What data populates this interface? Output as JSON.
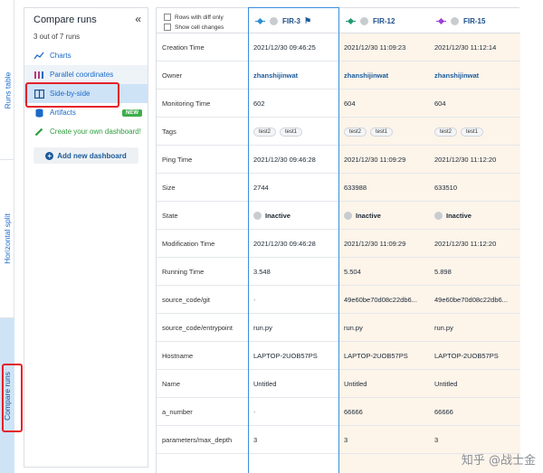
{
  "rail": {
    "tabs": [
      {
        "label": "Runs table"
      },
      {
        "label": "Horizontal split"
      },
      {
        "label": "Compare runs"
      }
    ]
  },
  "panel": {
    "title": "Compare runs",
    "subtitle": "3 out of 7 runs",
    "menu": [
      {
        "label": "Charts",
        "icon": "line-chart-icon"
      },
      {
        "label": "Parallel coordinates",
        "icon": "parallel-coordinates-icon"
      },
      {
        "label": "Side-by-side",
        "icon": "side-by-side-icon"
      },
      {
        "label": "Artifacts",
        "icon": "database-icon",
        "badge": "NEW"
      },
      {
        "label": "Create your own dashboard!",
        "icon": "pencil-icon"
      }
    ],
    "add_dashboard": "Add new dashboard"
  },
  "grid": {
    "toggles": {
      "diff_only": "Rows with diff only",
      "cell_changes": "Show cell changes"
    },
    "runs": [
      {
        "name": "FIR-3",
        "color": "#2a8fd4"
      },
      {
        "name": "FIR-12",
        "color": "#1f9a6e"
      },
      {
        "name": "FIR-15",
        "color": "#9b3fd4"
      }
    ],
    "rows": [
      {
        "label": "Creation Time",
        "values": [
          "2021/12/30 09:46:25",
          "2021/12/30 11:09:23",
          "2021/12/30 11:12:14"
        ]
      },
      {
        "label": "Owner",
        "values": [
          "zhanshijinwat",
          "zhanshijinwat",
          "zhanshijinwat"
        ]
      },
      {
        "label": "Monitoring Time",
        "values": [
          "602",
          "604",
          "604"
        ]
      },
      {
        "label": "Tags",
        "values": [
          [
            "test2",
            "test1"
          ],
          [
            "test2",
            "test1"
          ],
          [
            "test2",
            "test1"
          ]
        ]
      },
      {
        "label": "Ping Time",
        "values": [
          "2021/12/30 09:46:28",
          "2021/12/30 11:09:29",
          "2021/12/30 11:12:20"
        ]
      },
      {
        "label": "Size",
        "values": [
          "2744",
          "633988",
          "633510"
        ]
      },
      {
        "label": "State",
        "values": [
          "Inactive",
          "Inactive",
          "Inactive"
        ]
      },
      {
        "label": "Modification Time",
        "values": [
          "2021/12/30 09:46:28",
          "2021/12/30 11:09:29",
          "2021/12/30 11:12:20"
        ]
      },
      {
        "label": "Running Time",
        "values": [
          "3.548",
          "5.504",
          "5.898"
        ]
      },
      {
        "label": "source_code/git",
        "values": [
          "-",
          "49e60be70d08c22db6...",
          "49e60be70d08c22db6..."
        ]
      },
      {
        "label": "source_code/entrypoint",
        "values": [
          "run.py",
          "run.py",
          "run.py"
        ]
      },
      {
        "label": "Hostname",
        "values": [
          "LAPTOP-2UOB57PS",
          "LAPTOP-2UOB57PS",
          "LAPTOP-2UOB57PS"
        ]
      },
      {
        "label": "Name",
        "values": [
          "Untitled",
          "Untitled",
          "Untitled"
        ]
      },
      {
        "label": "a_number",
        "values": [
          "-",
          "66666",
          "66666"
        ]
      },
      {
        "label": "parameters/max_depth",
        "values": [
          "3",
          "3",
          "3"
        ]
      }
    ]
  },
  "watermark": "知乎 @战士金",
  "colors": {
    "accent": "#1b6ac9",
    "selected_bg": "#cfe3f7",
    "highlight_bg": "#fdf4ea",
    "annotation_red": "#e3212b",
    "new_badge": "#3fae4b"
  }
}
